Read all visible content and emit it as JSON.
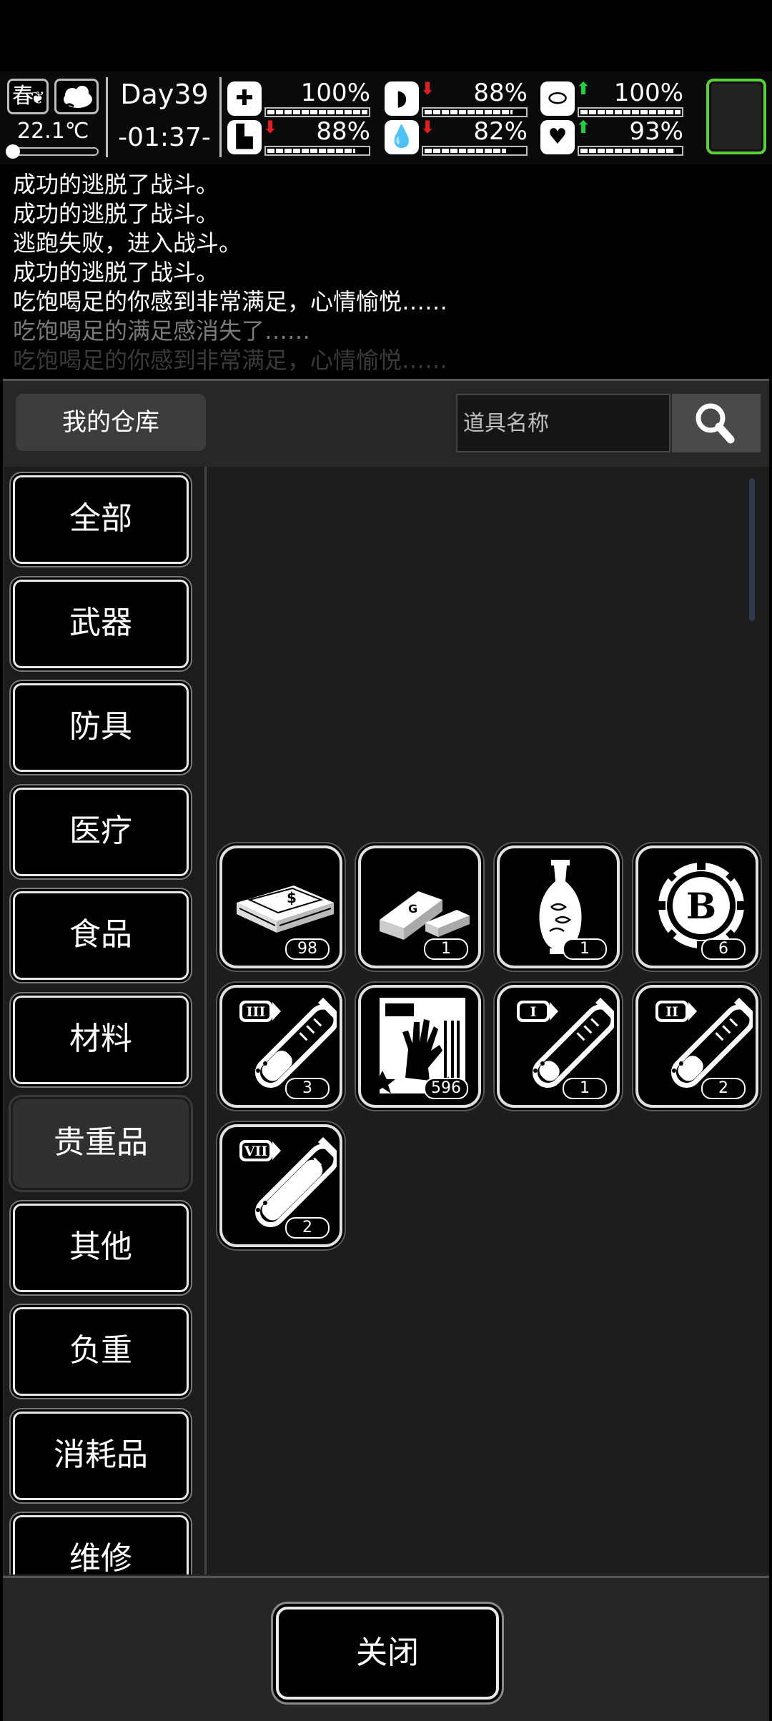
{
  "hud": {
    "season": "春",
    "temperature": "22.1℃",
    "day": "Day39",
    "clock": "-01:37-",
    "stats": [
      {
        "icon": "medkit-icon",
        "glyph": "✚",
        "value": "100%",
        "arrow": "",
        "level": 1.0
      },
      {
        "icon": "stomach-icon",
        "glyph": "◗",
        "value": "88%",
        "arrow": "down",
        "level": 0.88
      },
      {
        "icon": "pill-icon",
        "glyph": "⬭",
        "value": "100%",
        "arrow": "up",
        "level": 1.0
      },
      {
        "icon": "boot-icon",
        "glyph": "▙",
        "value": "88%",
        "arrow": "down",
        "level": 0.88
      },
      {
        "icon": "water-drop-icon",
        "glyph": "💧",
        "value": "82%",
        "arrow": "down",
        "level": 0.82
      },
      {
        "icon": "heart-icon",
        "glyph": "♥",
        "value": "93%",
        "arrow": "up",
        "level": 0.93
      }
    ]
  },
  "log": {
    "lines": [
      {
        "text": "成功的逃脱了战斗。",
        "color": "#ffffff"
      },
      {
        "text": "成功的逃脱了战斗。",
        "color": "#ffffff"
      },
      {
        "text": "逃跑失败，进入战斗。",
        "color": "#ffffff"
      },
      {
        "text": "成功的逃脱了战斗。",
        "color": "#ffffff"
      },
      {
        "text": "吃饱喝足的你感到非常满足，心情愉悦……",
        "color": "#ffffff"
      },
      {
        "text": "吃饱喝足的满足感消失了……",
        "color": "#7a7a7a"
      },
      {
        "text": "吃饱喝足的你感到非常满足，心情愉悦……",
        "color": "#3a3a3a"
      }
    ]
  },
  "warehouse": {
    "title": "我的仓库",
    "search_placeholder": "道具名称",
    "categories": [
      "全部",
      "武器",
      "防具",
      "医疗",
      "食品",
      "材料",
      "贵重品",
      "其他",
      "负重",
      "消耗品",
      "维修"
    ],
    "active_category": "贵重品",
    "items": [
      {
        "name": "cash-stack-icon",
        "count": "98"
      },
      {
        "name": "gold-bars-icon",
        "count": "1"
      },
      {
        "name": "porcelain-vase-icon",
        "count": "1"
      },
      {
        "name": "bitcoin-chip-icon",
        "count": "6"
      },
      {
        "name": "test-tube-iii-icon",
        "count": "3"
      },
      {
        "name": "zombie-hand-card-icon",
        "count": "596"
      },
      {
        "name": "test-tube-i-icon",
        "count": "1"
      },
      {
        "name": "test-tube-ii-icon",
        "count": "2"
      },
      {
        "name": "test-tube-vii-icon",
        "count": "2"
      }
    ],
    "close_label": "关闭"
  }
}
